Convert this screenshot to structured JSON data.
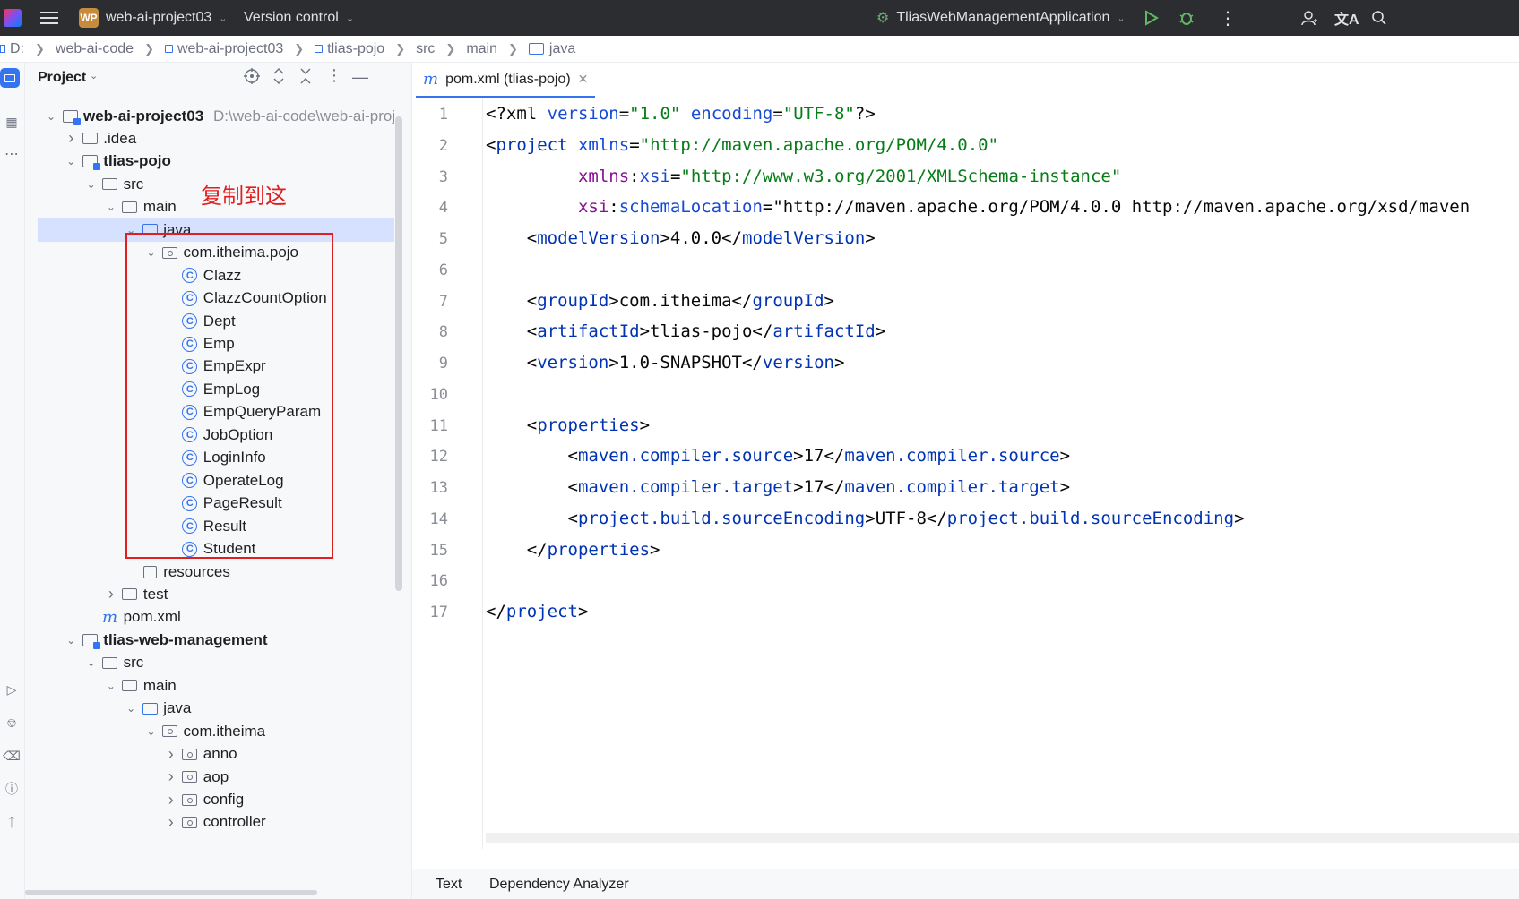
{
  "titlebar": {
    "project_badge": "WP",
    "project_name": "web-ai-project03",
    "vcs": "Version control",
    "run_config": "TliasWebManagementApplication"
  },
  "breadcrumb": [
    "D:",
    "web-ai-code",
    "web-ai-project03",
    "tlias-pojo",
    "src",
    "main",
    "java"
  ],
  "project_panel": {
    "title": "Project"
  },
  "tree": [
    {
      "label": "web-ai-project03",
      "hint": "D:\\web-ai-code\\web-ai-proj",
      "bold": true
    },
    {
      "label": ".idea"
    },
    {
      "label": "tlias-pojo",
      "bold": true
    },
    {
      "label": "src"
    },
    {
      "label": "main"
    },
    {
      "label": "java"
    },
    {
      "label": "com.itheima.pojo"
    },
    {
      "label": "Clazz"
    },
    {
      "label": "ClazzCountOption"
    },
    {
      "label": "Dept"
    },
    {
      "label": "Emp"
    },
    {
      "label": "EmpExpr"
    },
    {
      "label": "EmpLog"
    },
    {
      "label": "EmpQueryParam"
    },
    {
      "label": "JobOption"
    },
    {
      "label": "LoginInfo"
    },
    {
      "label": "OperateLog"
    },
    {
      "label": "PageResult"
    },
    {
      "label": "Result"
    },
    {
      "label": "Student"
    },
    {
      "label": "resources"
    },
    {
      "label": "test"
    },
    {
      "label": "pom.xml"
    },
    {
      "label": "tlias-web-management",
      "bold": true
    },
    {
      "label": "src"
    },
    {
      "label": "main"
    },
    {
      "label": "java"
    },
    {
      "label": "com.itheima"
    },
    {
      "label": "anno"
    },
    {
      "label": "aop"
    },
    {
      "label": "config"
    },
    {
      "label": "controller"
    }
  ],
  "annotation": "复制到这",
  "editor": {
    "tab_label": "pom.xml (tlias-pojo)",
    "line_numbers": [
      "1",
      "2",
      "3",
      "4",
      "5",
      "6",
      "7",
      "8",
      "9",
      "10",
      "11",
      "12",
      "13",
      "14",
      "15",
      "16",
      "17"
    ],
    "bottom_tabs": [
      "Text",
      "Dependency Analyzer"
    ]
  },
  "code_lines": [
    "<?xml version=\"1.0\" encoding=\"UTF-8\"?>",
    "<project xmlns=\"http://maven.apache.org/POM/4.0.0\"",
    "         xmlns:xsi=\"http://www.w3.org/2001/XMLSchema-instance\"",
    "         xsi:schemaLocation=\"http://maven.apache.org/POM/4.0.0 http://maven.apache.org/xsd/maven",
    "    <modelVersion>4.0.0</modelVersion>",
    "",
    "    <groupId>com.itheima</groupId>",
    "    <artifactId>tlias-pojo</artifactId>",
    "    <version>1.0-SNAPSHOT</version>",
    "",
    "    <properties>",
    "        <maven.compiler.source>17</maven.compiler.source>",
    "        <maven.compiler.target>17</maven.compiler.target>",
    "        <project.build.sourceEncoding>UTF-8</project.build.sourceEncoding>",
    "    </properties>",
    "",
    "</project>"
  ]
}
